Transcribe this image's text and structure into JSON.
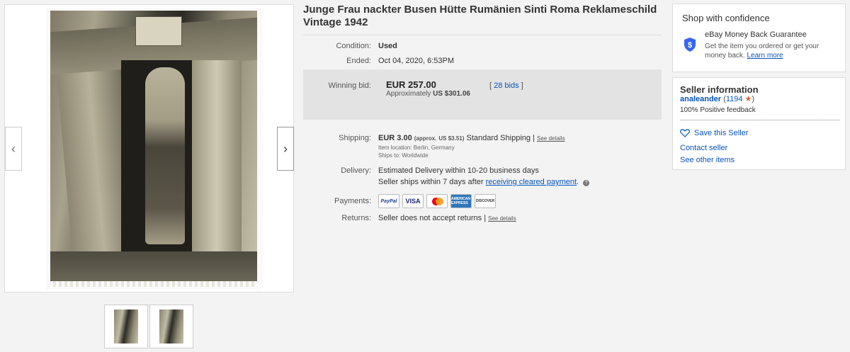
{
  "gallery": {
    "prev_arrow": "‹",
    "next_arrow": "›",
    "thumbnail_count": 2
  },
  "item": {
    "title": "Junge Frau nackter Busen Hütte Rumänien Sinti Roma Reklameschild Vintage 1942",
    "condition_label": "Condition:",
    "condition_value": "Used",
    "ended_label": "Ended:",
    "ended_value": "Oct 04, 2020, 6:53PM"
  },
  "bid": {
    "label": "Winning bid:",
    "price": "EUR 257.00",
    "approx_prefix": "Approximately",
    "approx_value": "US $301.06",
    "bids_open": "[",
    "bids_link": "28 bids",
    "bids_close": "]"
  },
  "shipping": {
    "label": "Shipping:",
    "price": "EUR 3.00",
    "approx": "(approx.",
    "approx_value": "US $3.51)",
    "method": "Standard Shipping |",
    "see_details": "See details",
    "location": "Item location:   Berlin, Germany",
    "ships_to": "Ships to:   Worldwide"
  },
  "delivery": {
    "label": "Delivery:",
    "estimate": "Estimated Delivery within 10-20 business days",
    "note_prefix": "Seller ships within 7 days after",
    "note_link": "receiving cleared payment",
    "note_suffix": "."
  },
  "payments": {
    "label": "Payments:",
    "methods": [
      "PayPal",
      "VISA",
      "MasterCard",
      "AMERICAN EXPRESS",
      "DISCOVER"
    ]
  },
  "returns": {
    "label": "Returns:",
    "value": "Seller does not accept returns |",
    "see_details": "See details"
  },
  "confidence": {
    "title": "Shop with confidence",
    "guarantee_title": "eBay Money Back Guarantee",
    "guarantee_desc": "Get the item you ordered or get your money back.",
    "learn_more": "Learn more",
    "shield_color": "#3665f3"
  },
  "seller": {
    "title": "Seller information",
    "name": "analeander",
    "score": "1194",
    "feedback": "100% Positive feedback",
    "save": "Save this Seller",
    "contact": "Contact seller",
    "other_items": "See other items",
    "star_color": "#e85c2a"
  }
}
